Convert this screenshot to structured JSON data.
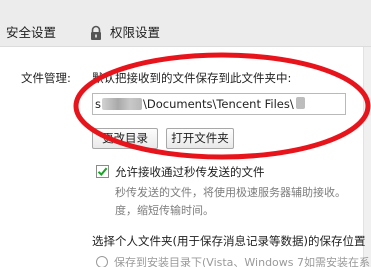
{
  "tabs": {
    "security_label": "安全设置",
    "permission_label": "权限设置",
    "permission_icon": "lock-icon"
  },
  "file_management": {
    "section_label": "文件管理:",
    "default_save_label": "默认把接收到的文件保存到此文件夹中:",
    "path_prefix": "s",
    "path_middle": "\\Documents\\Tencent Files\\",
    "change_dir_button": "更改目录",
    "open_folder_button": "打开文件夹",
    "accept_checkbox_label": "允许接收通过秒传发送的文件",
    "accept_checkbox_checked": true,
    "desc_line1": "秒传发送的文件，将使用极速服务器辅助接收。",
    "desc_line2": "度，缩短传输时间。"
  },
  "personal_folder": {
    "label": "选择个人文件夹(用于保存消息记录等数据)的保存位置",
    "option_label": "保存到安装目录下(Vista、Windows 7如需安装在系"
  },
  "colors": {
    "highlight": "#e8141b",
    "checkmark": "#1aa324"
  }
}
